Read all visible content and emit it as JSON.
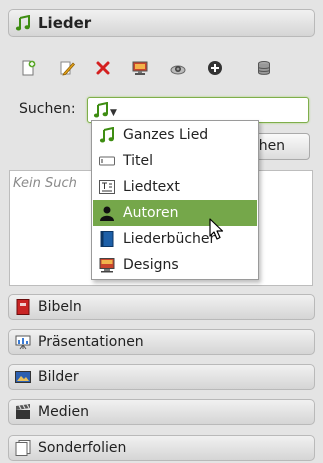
{
  "header": {
    "title": "Lieder",
    "icon": "music-note-icon"
  },
  "toolbar": {
    "buttons": [
      {
        "name": "new-song-button",
        "icon": "new-document-icon"
      },
      {
        "name": "edit-song-button",
        "icon": "edit-pencil-icon"
      },
      {
        "name": "delete-song-button",
        "icon": "delete-x-icon"
      },
      {
        "name": "add-to-presentation-button",
        "icon": "presentation-icon"
      },
      {
        "name": "preview-button",
        "icon": "camera-icon"
      },
      {
        "name": "add-button",
        "icon": "plus-circle-icon"
      },
      {
        "name": "database-button",
        "icon": "database-icon"
      }
    ]
  },
  "search": {
    "label": "Suchen:",
    "button_label": "Suchen",
    "button_visible_text": "chen",
    "results_placeholder": "Kein Suchergebnis",
    "results_visible_text": "Kein Such"
  },
  "dropdown": {
    "items": [
      {
        "label": "Ganzes Lied",
        "icon": "music-note-icon",
        "selected": false
      },
      {
        "label": "Titel",
        "icon": "title-field-icon",
        "selected": false
      },
      {
        "label": "Liedtext",
        "icon": "text-lines-icon",
        "selected": false
      },
      {
        "label": "Autoren",
        "icon": "person-icon",
        "selected": true
      },
      {
        "label": "Liederbücher",
        "icon": "book-icon",
        "selected": false
      },
      {
        "label": "Designs",
        "icon": "monitor-icon",
        "selected": false
      }
    ],
    "selected_color": "#75a74a"
  },
  "sections": [
    {
      "label": "Bibeln",
      "icon": "bible-icon"
    },
    {
      "label": "Präsentationen",
      "icon": "chart-board-icon"
    },
    {
      "label": "Bilder",
      "icon": "image-icon"
    },
    {
      "label": "Medien",
      "icon": "film-clapper-icon"
    },
    {
      "label": "Sonderfolien",
      "icon": "pages-icon"
    }
  ],
  "colors": {
    "accent": "#4f9a1f",
    "panel_bg": "#e4e4e4"
  }
}
